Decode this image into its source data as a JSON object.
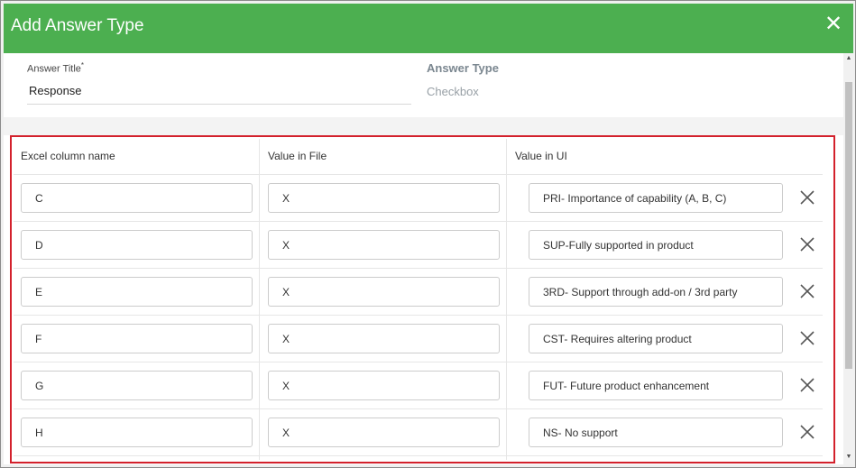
{
  "dialog": {
    "title": "Add Answer Type",
    "close_icon": "close-icon"
  },
  "form": {
    "answer_title_label": "Answer Title",
    "required_mark": "*",
    "answer_title_value": "Response",
    "answer_type_label": "Answer Type",
    "answer_type_value": "Checkbox"
  },
  "mapping": {
    "headers": [
      "Excel column name",
      "Value in File",
      "Value in UI"
    ],
    "rows": [
      {
        "column": "C",
        "file": "X",
        "ui": "PRI- Importance of capability (A, B, C)"
      },
      {
        "column": "D",
        "file": "X",
        "ui": "SUP-Fully supported in product"
      },
      {
        "column": "E",
        "file": "X",
        "ui": "3RD- Support through add-on / 3rd party"
      },
      {
        "column": "F",
        "file": "X",
        "ui": "CST- Requires altering product"
      },
      {
        "column": "G",
        "file": "X",
        "ui": "FUT- Future product enhancement"
      },
      {
        "column": "H",
        "file": "X",
        "ui": "NS- No support"
      }
    ],
    "remove_icon": "x-icon"
  },
  "colors": {
    "header_bg": "#4caf50",
    "highlight_border": "#d3212c"
  }
}
